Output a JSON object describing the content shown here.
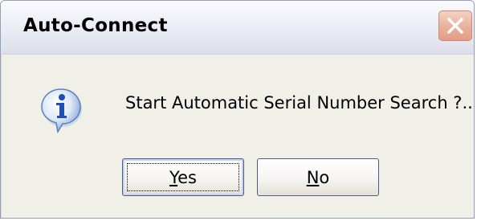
{
  "window": {
    "title": "Auto-Connect"
  },
  "dialog": {
    "message": "Start Automatic Serial Number Search ?...",
    "icon": "information-icon"
  },
  "buttons": {
    "yes": {
      "mnemonic": "Y",
      "rest": "es"
    },
    "no": {
      "mnemonic": "N",
      "rest": "o"
    }
  },
  "colors": {
    "dialog_background": "#ece9d8",
    "close_button": "#e59c84"
  }
}
